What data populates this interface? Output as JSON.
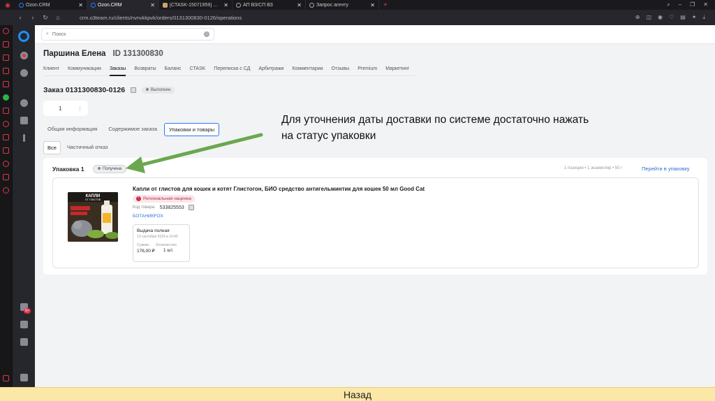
{
  "browser": {
    "tabs": [
      {
        "label": "Ozon.CRM",
        "favicon": "ozon-icon"
      },
      {
        "label": "Ozon.CRM",
        "favicon": "ozon-icon",
        "active": true
      },
      {
        "label": "[CTASK-15071959] Статус с",
        "favicon": "jira-icon"
      },
      {
        "label": "АП ВЗ/СП ВЗ",
        "favicon": "drive-icon"
      },
      {
        "label": "Запрос агенту",
        "favicon": "drive-icon"
      }
    ],
    "url": "crm.o3team.ru/clients/nvnvkkpvk/orders/0131300830-0126/operations"
  },
  "search": {
    "placeholder": "Поиск"
  },
  "customer": {
    "name": "Паршина Елена",
    "id": "ID 131300830"
  },
  "nav_tabs": [
    "Клиент",
    "Коммуникации",
    "Заказы",
    "Возвраты",
    "Баланс",
    "CTASK",
    "Переписка с СД",
    "Арбитражи",
    "Комментарии",
    "Отзывы",
    "Premium",
    "Маркетинг"
  ],
  "active_nav_tab": "Заказы",
  "order": {
    "title": "Заказ 0131300830-0126",
    "status": "Выполнен",
    "counter": "1",
    "more": "⋮"
  },
  "sub_tabs": [
    "Общая информация",
    "Содержимое заказа",
    "Упаковки и товары"
  ],
  "filters": [
    "Все",
    "Частичный отказ"
  ],
  "package": {
    "title": "Упаковка 1",
    "status": "Получена",
    "meta": "1 позиция • 1 экземпляр • 50 г",
    "link": "Перейти в упаковку"
  },
  "item": {
    "name": "Капли от глистов для кошек и котят Глистогон, БИО средство антигельминтик для кошек 50 мл Good Cat",
    "badge": "Региональная наценка",
    "sku_label": "Код товара:",
    "sku": "533825553",
    "seller": "БОТАНИКFOX",
    "image_text": {
      "line1": "КАПЛИ",
      "line2": "ОТ ГЛИСТОВ"
    },
    "delivery": {
      "title": "Выдача полная",
      "date": "13 сентября 2024 в 10:45",
      "sum_label": "Сумма",
      "qty_label": "Количество",
      "sum": "176,00 ₽",
      "qty": "1 шт."
    }
  },
  "annotation": {
    "line1": "Для уточнения даты доставки по системе достаточно нажать",
    "line2": "на статус упаковки"
  },
  "bottom": {
    "back_label": "Назад"
  },
  "colors": {
    "accent": "#2b77ff",
    "arrow": "#6aa84f",
    "browser_accent": "#e0354a",
    "bottom_bar": "#fbe7a6"
  }
}
